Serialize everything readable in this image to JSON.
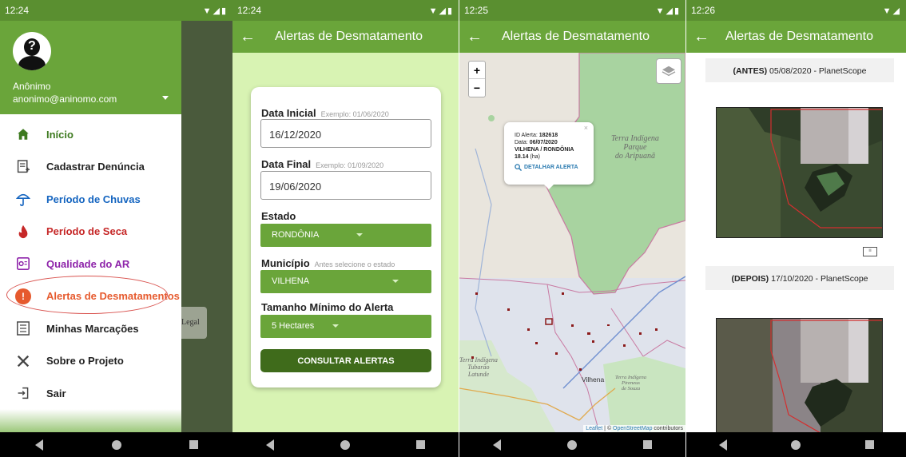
{
  "screens": [
    {
      "status": {
        "time": "12:24"
      }
    },
    {
      "status": {
        "time": "12:24"
      }
    },
    {
      "status": {
        "time": "12:25"
      }
    },
    {
      "status": {
        "time": "12:26"
      }
    }
  ],
  "colors": {
    "primary": "#6aa53a",
    "dark_button": "#3f6b1b",
    "form_bg": "#d8f3b3",
    "highlight_oval": "#d9534f"
  },
  "drawer": {
    "user_name": "Anônimo",
    "user_email": "anonimo@aninomo.com",
    "items": [
      {
        "label": "Início",
        "icon": "home-icon",
        "color": "#3d7a1f"
      },
      {
        "label": "Cadastrar Denúncia",
        "icon": "report-add-icon",
        "color": "#222222"
      },
      {
        "label": "Período de Chuvas",
        "icon": "umbrella-icon",
        "color": "#1565c0"
      },
      {
        "label": "Período de Seca",
        "icon": "fire-icon",
        "color": "#c62828"
      },
      {
        "label": "Qualidade do AR",
        "icon": "air-quality-icon",
        "color": "#8e24aa"
      },
      {
        "label": "Alertas de Desmatamentos",
        "icon": "deforestation-alert-icon",
        "color": "#e65a2e"
      },
      {
        "label": "Minhas Marcações",
        "icon": "list-icon",
        "color": "#222222"
      },
      {
        "label": "Sobre o Projeto",
        "icon": "tools-icon",
        "color": "#222222"
      },
      {
        "label": "Sair",
        "icon": "logout-icon",
        "color": "#222222"
      }
    ],
    "behind_label": "Legal"
  },
  "form": {
    "app_title": "Alertas de Desmatamento",
    "data_inicial_label": "Data Inicial",
    "data_inicial_hint": "Exemplo: 01/06/2020",
    "data_inicial_value": "16/12/2020",
    "data_final_label": "Data Final",
    "data_final_hint": "Exemplo: 01/09/2020",
    "data_final_value": "19/06/2020",
    "estado_label": "Estado",
    "estado_value": "RONDÔNIA",
    "municipio_label": "Município",
    "municipio_hint": "Antes selecione o estado",
    "municipio_value": "VILHENA",
    "tamanho_label": "Tamanho Mínimo do Alerta",
    "tamanho_value": "5 Hectares",
    "button_label": "CONSULTAR ALERTAS"
  },
  "map": {
    "app_title": "Alertas de Desmatamento",
    "zoom_in": "+",
    "zoom_out": "−",
    "popup": {
      "id_label": "ID Alerta:",
      "id_value": "182618",
      "date_label": "Data:",
      "date_value": "06/07/2020",
      "location": "VILHENA / RONDÔNIA",
      "area_value": "18.14",
      "area_unit": "(ha)",
      "action": "DETALHAR ALERTA",
      "close": "×"
    },
    "labels": {
      "ti_parque_1": "Terra Indígena",
      "ti_parque_2": "Parque",
      "ti_parque_3": "do Aripuanã",
      "ti_tubarao_1": "Terra Indígena",
      "ti_tubarao_2": "Tubarão",
      "ti_tubarao_3": "Latunde",
      "vilhena": "Vilhena",
      "ti_pireneus_1": "Terra Indígena",
      "ti_pireneus_2": "Pireneus",
      "ti_pireneus_3": "de Souza"
    },
    "attribution_leaflet": "Leaflet",
    "attribution_sep": " | © ",
    "attribution_osm": "OpenStreetMap",
    "attribution_tail": " contributors"
  },
  "images": {
    "app_title": "Alertas de Desmatamento",
    "before_tag": "(ANTES)",
    "before_text": "05/08/2020 - PlanetScope",
    "after_tag": "(DEPOIS)",
    "after_text": "17/10/2020 - PlanetScope"
  }
}
